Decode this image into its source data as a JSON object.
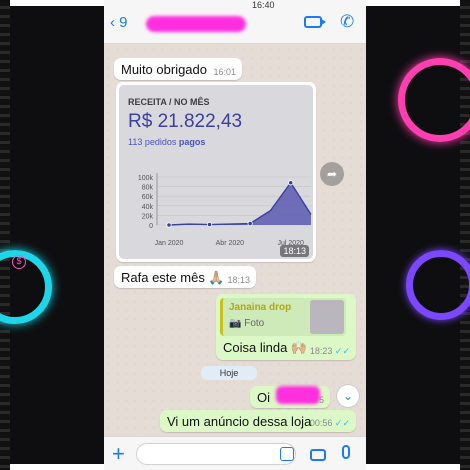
{
  "header": {
    "back_count": "9",
    "clock": "16:40"
  },
  "messages": {
    "m1": {
      "text": "Muito obrigado",
      "time": "16:01"
    },
    "image": {
      "label": "RECEITA / NO MÊS",
      "value": "R$ 21.822,43",
      "orders_count": "113 pedidos",
      "orders_status": "pagos",
      "time": "18:13",
      "chart_data": {
        "type": "area",
        "y_ticks": [
          "100k",
          "80k",
          "60k",
          "40k",
          "20k",
          "0"
        ],
        "x_ticks": [
          "Jan 2020",
          "Abr 2020",
          "Jul 2020"
        ],
        "x": [
          "Jan 2020",
          "Fev 2020",
          "Mar 2020",
          "Abr 2020",
          "Mai 2020",
          "Jun 2020",
          "Jul 2020",
          "Ago 2020"
        ],
        "values": [
          0,
          2,
          1,
          2,
          3,
          30,
          88,
          22
        ],
        "ylim": [
          0,
          100
        ]
      }
    },
    "m2": {
      "text": "Rafa este mês 🙏🏼",
      "time": "18:13"
    },
    "reply": {
      "quoted_name": "Janaina drop",
      "quoted_type": "Foto",
      "text": "Coisa linda 🙌🏼",
      "time": "18:23"
    },
    "day_label": "Hoje",
    "m3": {
      "text": "Oi",
      "time": "00:5"
    },
    "m4": {
      "text": "Vi um anúncio dessa loja",
      "time": "00:56"
    }
  },
  "colors": {
    "accent": "#1a7cf5",
    "outgoing": "#dcf8c6",
    "incoming": "#ffffff",
    "chart_fill": "#5a5ab0"
  }
}
